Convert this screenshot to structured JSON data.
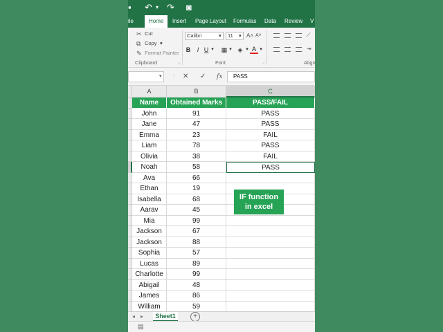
{
  "ribbon_tabs": [
    "ile",
    "Home",
    "Insert",
    "Page Layout",
    "Formulas",
    "Data",
    "Review",
    "V"
  ],
  "clipboard": {
    "cut": "Cut",
    "copy": "Copy",
    "format_painter": "Format Painter",
    "group_label": "Clipboard"
  },
  "font": {
    "family": "Calibri",
    "size": "11",
    "bold": "B",
    "italic": "I",
    "underline": "U",
    "group_label": "Font"
  },
  "alignment": {
    "group_label_partial": "Align"
  },
  "formula_bar": {
    "name_box": "",
    "content": "PASS",
    "cancel_glyph": "✕",
    "enter_glyph": "✓",
    "fx_glyph": "fx"
  },
  "grid": {
    "columns": [
      "A",
      "B",
      "C"
    ],
    "header": [
      "Name",
      "Obtained Marks",
      "PASS/FAIL"
    ],
    "rows": [
      [
        "John",
        "91",
        "PASS"
      ],
      [
        "Jane",
        "47",
        "PASS"
      ],
      [
        "Emma",
        "23",
        "FAIL"
      ],
      [
        "Liam",
        "78",
        "PASS"
      ],
      [
        "Olivia",
        "38",
        "FAIL"
      ],
      [
        "Noah",
        "58",
        "PASS"
      ],
      [
        "Ava",
        "66",
        ""
      ],
      [
        "Ethan",
        "19",
        ""
      ],
      [
        "Isabella",
        "68",
        ""
      ],
      [
        "Aarav",
        "45",
        ""
      ],
      [
        "Mia",
        "99",
        ""
      ],
      [
        "Jackson",
        "67",
        ""
      ],
      [
        "Jackson",
        "88",
        ""
      ],
      [
        "Sophia",
        "57",
        ""
      ],
      [
        "Lucas",
        "89",
        ""
      ],
      [
        "Charlotte",
        "99",
        ""
      ],
      [
        "Abigail",
        "48",
        ""
      ],
      [
        "James",
        "86",
        ""
      ],
      [
        "William",
        "59",
        ""
      ]
    ]
  },
  "callout": {
    "line1": "IF function",
    "line2": "in excel"
  },
  "sheet_tabs": [
    "Sheet1"
  ],
  "colors": {
    "excel_green": "#217346",
    "header_fill": "#27a356",
    "background": "#3f8a5f"
  }
}
